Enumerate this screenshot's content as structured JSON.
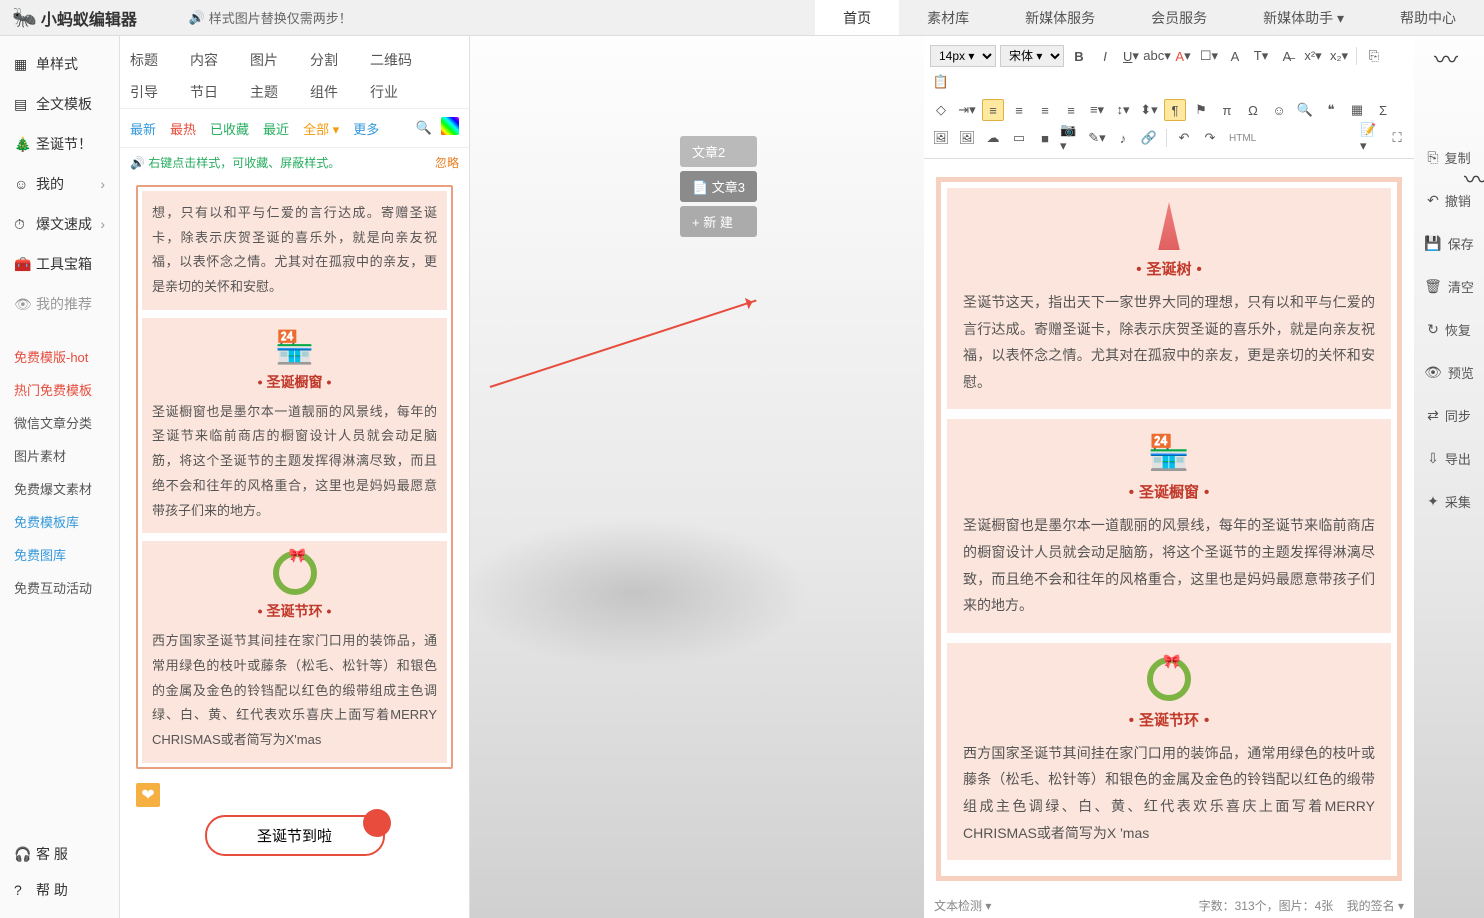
{
  "logo": "小蚂蚁编辑器",
  "announce": "样式图片替换仅需两步！",
  "topnav": [
    "首页",
    "素材库",
    "新媒体服务",
    "会员服务",
    "新媒体助手 ▾",
    "帮助中心"
  ],
  "sidebar": {
    "main": [
      {
        "icon": "▦",
        "label": "单样式"
      },
      {
        "icon": "▤",
        "label": "全文模板"
      },
      {
        "icon": "🎄",
        "label": "圣诞节！"
      },
      {
        "icon": "☺",
        "label": "我的"
      },
      {
        "icon": "⏱",
        "label": "爆文速成"
      },
      {
        "icon": "🧰",
        "label": "工具宝箱"
      },
      {
        "icon": "👁",
        "label": "我的推荐",
        "muted": true
      }
    ],
    "links": [
      {
        "label": "免费模版-hot",
        "cls": "hot"
      },
      {
        "label": "热门免费模板",
        "cls": "hot"
      },
      {
        "label": "微信文章分类",
        "cls": ""
      },
      {
        "label": "图片素材",
        "cls": ""
      },
      {
        "label": "免费爆文素材",
        "cls": ""
      },
      {
        "label": "免费模板库",
        "cls": "blue"
      },
      {
        "label": "免费图库",
        "cls": "blue"
      },
      {
        "label": "免费互动活动",
        "cls": ""
      }
    ],
    "bottom": [
      {
        "icon": "🎧",
        "label": "客 服"
      },
      {
        "icon": "?",
        "label": "帮 助"
      }
    ]
  },
  "styletabs_row1": [
    "标题",
    "内容",
    "图片",
    "分割",
    "二维码"
  ],
  "styletabs_row2": [
    "引导",
    "节日",
    "主题",
    "组件",
    "行业"
  ],
  "filters": [
    {
      "label": "最新",
      "cls": ""
    },
    {
      "label": "最热",
      "cls": "hot"
    },
    {
      "label": "已收藏",
      "cls": "green"
    },
    {
      "label": "最近",
      "cls": "green"
    },
    {
      "label": "全部 ▾",
      "cls": "orange"
    },
    {
      "label": "更多",
      "cls": ""
    }
  ],
  "style_hint": "右键点击样式，可收藏、屏蔽样式。",
  "ignore": "忽略",
  "cards": {
    "c1_text": "想，只有以和平与仁爱的言行达成。寄赠圣诞卡，除表示庆贺圣诞的喜乐外，就是向亲友祝福，以表怀念之情。尤其对在孤寂中的亲友，更是亲切的关怀和安慰。",
    "c2_title": "圣诞橱窗",
    "c2_text": "圣诞橱窗也是墨尔本一道靓丽的风景线，每年的圣诞节来临前商店的橱窗设计人员就会动足脑筋，将这个圣诞节的主题发挥得淋漓尽致，而且绝不会和往年的风格重合，这里也是妈妈最愿意带孩子们来的地方。",
    "c3_title": "圣诞节环",
    "c3_text": "西方国家圣诞节其间挂在家门口用的装饰品，通常用绿色的枝叶或藤条（松毛、松针等）和银色的金属及金色的铃铛配以红色的缎带组成主色调绿、白、黄、红代表欢乐喜庆上面写着MERRY CHRISMAS或者简写为X'mas",
    "bottom_label": "圣诞节到啦"
  },
  "doctabs": [
    "文章2",
    "📄 文章3",
    "+ 新 建"
  ],
  "editor": {
    "fontsize": "14px ▾",
    "fontfam": "宋体 ▾",
    "cards": [
      {
        "title": "圣诞树",
        "text": "圣诞节这天，指出天下一家世界大同的理想，只有以和平与仁爱的言行达成。寄赠圣诞卡，除表示庆贺圣诞的喜乐外，就是向亲友祝福，以表怀念之情。尤其对在孤寂中的亲友，更是亲切的关怀和安慰。"
      },
      {
        "title": "圣诞橱窗",
        "text": "圣诞橱窗也是墨尔本一道靓丽的风景线，每年的圣诞节来临前商店的橱窗设计人员就会动足脑筋，将这个圣诞节的主题发挥得淋漓尽致，而且绝不会和往年的风格重合，这里也是妈妈最愿意带孩子们来的地方。"
      },
      {
        "title": "圣诞节环",
        "text": "西方国家圣诞节其间挂在家门口用的装饰品，通常用绿色的枝叶或藤条（松毛、松针等）和银色的金属及金色的铃铛配以红色的缎带组成主色调绿、白、黄、红代表欢乐喜庆上面写着MERRY CHRISMAS或者简写为X 'mas"
      }
    ],
    "footer_left": "文本检测 ▾",
    "footer_stats": "字数：313个，图片：4张",
    "footer_right": "我的签名 ▾"
  },
  "actions": [
    {
      "icon": "⎘",
      "label": "复制"
    },
    {
      "icon": "↶",
      "label": "撤销"
    },
    {
      "icon": "💾",
      "label": "保存"
    },
    {
      "icon": "🗑",
      "label": "清空"
    },
    {
      "icon": "↻",
      "label": "恢复"
    },
    {
      "icon": "👁",
      "label": "预览"
    },
    {
      "icon": "⇄",
      "label": "同步"
    },
    {
      "icon": "⇩",
      "label": "导出"
    },
    {
      "icon": "✦",
      "label": "采集"
    }
  ]
}
